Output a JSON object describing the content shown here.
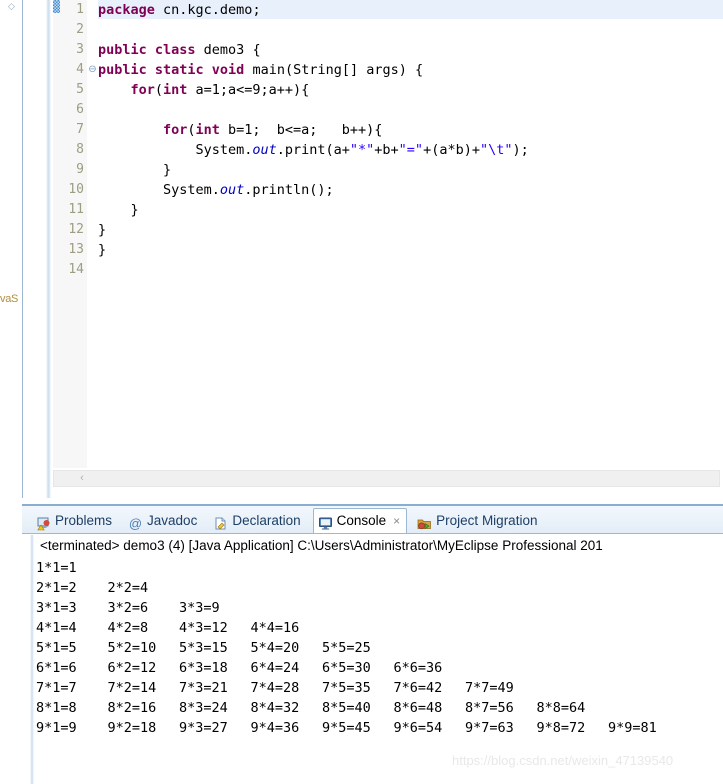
{
  "left_bar": {
    "vertical_label": "vaS",
    "chevron": "◇"
  },
  "editor": {
    "line_numbers": [
      "1",
      "2",
      "3",
      "4",
      "5",
      "6",
      "7",
      "8",
      "9",
      "10",
      "11",
      "12",
      "13",
      "14"
    ],
    "fold_marker_line": 4,
    "fold_marker_glyph": "⊖",
    "current_line": 1,
    "hscroll_left_arrow": "‹",
    "lines": [
      {
        "n": 1,
        "indent": 0,
        "tokens": [
          {
            "t": "package",
            "c": "kw"
          },
          {
            "t": " cn.kgc.demo;",
            "c": ""
          }
        ]
      },
      {
        "n": 2,
        "indent": 0,
        "tokens": []
      },
      {
        "n": 3,
        "indent": 0,
        "tokens": [
          {
            "t": "public class",
            "c": "kw"
          },
          {
            "t": " demo3 {",
            "c": ""
          }
        ]
      },
      {
        "n": 4,
        "indent": 0,
        "tokens": [
          {
            "t": "public static void",
            "c": "kw"
          },
          {
            "t": " main(String[] args) {",
            "c": ""
          }
        ]
      },
      {
        "n": 5,
        "indent": 1,
        "tokens": [
          {
            "t": "for",
            "c": "kw"
          },
          {
            "t": "(",
            "c": ""
          },
          {
            "t": "int",
            "c": "kw"
          },
          {
            "t": " a=1;a<=9;a++){",
            "c": ""
          }
        ]
      },
      {
        "n": 6,
        "indent": 0,
        "tokens": []
      },
      {
        "n": 7,
        "indent": 2,
        "tokens": [
          {
            "t": "for",
            "c": "kw"
          },
          {
            "t": "(",
            "c": ""
          },
          {
            "t": "int",
            "c": "kw"
          },
          {
            "t": " b=1;  b<=a;   b++){",
            "c": ""
          }
        ]
      },
      {
        "n": 8,
        "indent": 3,
        "tokens": [
          {
            "t": "System.",
            "c": ""
          },
          {
            "t": "out",
            "c": "fld"
          },
          {
            "t": ".print(a+",
            "c": ""
          },
          {
            "t": "\"*\"",
            "c": "str"
          },
          {
            "t": "+b+",
            "c": ""
          },
          {
            "t": "\"=\"",
            "c": "str"
          },
          {
            "t": "+(a*b)+",
            "c": ""
          },
          {
            "t": "\"\\t\"",
            "c": "str"
          },
          {
            "t": ");",
            "c": ""
          }
        ]
      },
      {
        "n": 9,
        "indent": 2,
        "tokens": [
          {
            "t": "}",
            "c": ""
          }
        ]
      },
      {
        "n": 10,
        "indent": 2,
        "tokens": [
          {
            "t": "System.",
            "c": ""
          },
          {
            "t": "out",
            "c": "fld"
          },
          {
            "t": ".println();",
            "c": ""
          }
        ]
      },
      {
        "n": 11,
        "indent": 1,
        "tokens": [
          {
            "t": "}",
            "c": ""
          }
        ]
      },
      {
        "n": 12,
        "indent": 0,
        "tokens": [
          {
            "t": "}",
            "c": ""
          }
        ]
      },
      {
        "n": 13,
        "indent": 0,
        "tokens": [
          {
            "t": "}",
            "c": ""
          }
        ]
      },
      {
        "n": 14,
        "indent": 0,
        "tokens": []
      }
    ]
  },
  "view_tabs": [
    {
      "label": "Problems",
      "icon": "problems-icon",
      "active": false,
      "closable": false
    },
    {
      "label": "Javadoc",
      "icon": "javadoc-at-icon",
      "active": false,
      "closable": false
    },
    {
      "label": "Declaration",
      "icon": "declaration-icon",
      "active": false,
      "closable": false
    },
    {
      "label": "Console",
      "icon": "console-icon",
      "active": true,
      "closable": true
    },
    {
      "label": "Project Migration",
      "icon": "project-migration-icon",
      "active": false,
      "closable": false
    }
  ],
  "tab_close_glyph": "×",
  "console": {
    "terminated_line": "<terminated> demo3 (4) [Java Application] C:\\Users\\Administrator\\MyEclipse Professional 201",
    "rows": [
      [
        "1*1=1"
      ],
      [
        "2*1=2",
        "2*2=4"
      ],
      [
        "3*1=3",
        "3*2=6",
        "3*3=9"
      ],
      [
        "4*1=4",
        "4*2=8",
        "4*3=12",
        "4*4=16"
      ],
      [
        "5*1=5",
        "5*2=10",
        "5*3=15",
        "5*4=20",
        "5*5=25"
      ],
      [
        "6*1=6",
        "6*2=12",
        "6*3=18",
        "6*4=24",
        "6*5=30",
        "6*6=36"
      ],
      [
        "7*1=7",
        "7*2=14",
        "7*3=21",
        "7*4=28",
        "7*5=35",
        "7*6=42",
        "7*7=49"
      ],
      [
        "8*1=8",
        "8*2=16",
        "8*3=24",
        "8*4=32",
        "8*5=40",
        "8*6=48",
        "8*7=56",
        "8*8=64"
      ],
      [
        "9*1=9",
        "9*2=18",
        "9*3=27",
        "9*4=36",
        "9*5=45",
        "9*6=54",
        "9*7=63",
        "9*8=72",
        "9*9=81"
      ]
    ]
  },
  "watermark": "https://blog.csdn.net/weixin_47139540",
  "colors": {
    "keyword": "#7f0055",
    "string": "#2a00ff",
    "field": "#0000c0",
    "current_line_highlight": "#e8f0fc",
    "tab_border": "#9cb8d4",
    "gutter_text": "#9d9d82"
  }
}
